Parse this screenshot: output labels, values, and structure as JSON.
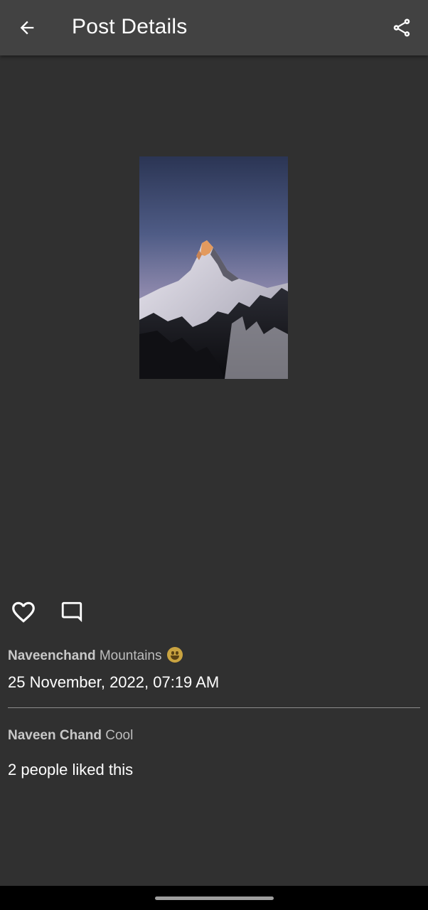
{
  "app_bar": {
    "title": "Post Details",
    "back_icon": "arrow-back-icon",
    "share_icon": "share-icon"
  },
  "post": {
    "image_subject": "mountain-peak-photo",
    "like_icon": "heart-outline-icon",
    "comment_icon": "comment-icon",
    "author": "Naveenchand",
    "caption": "Mountains",
    "caption_emoji": "grinning-face-emoji",
    "datetime": "25 November, 2022, 07:19 AM"
  },
  "comments": [
    {
      "author": "Naveen Chand",
      "text": "Cool"
    }
  ],
  "likes_text": "2 people liked this",
  "colors": {
    "background": "#303030",
    "app_bar": "#424242",
    "primary_text": "#ffffff",
    "secondary_text": "#bdbdbd",
    "divider": "#8c8c8c"
  }
}
